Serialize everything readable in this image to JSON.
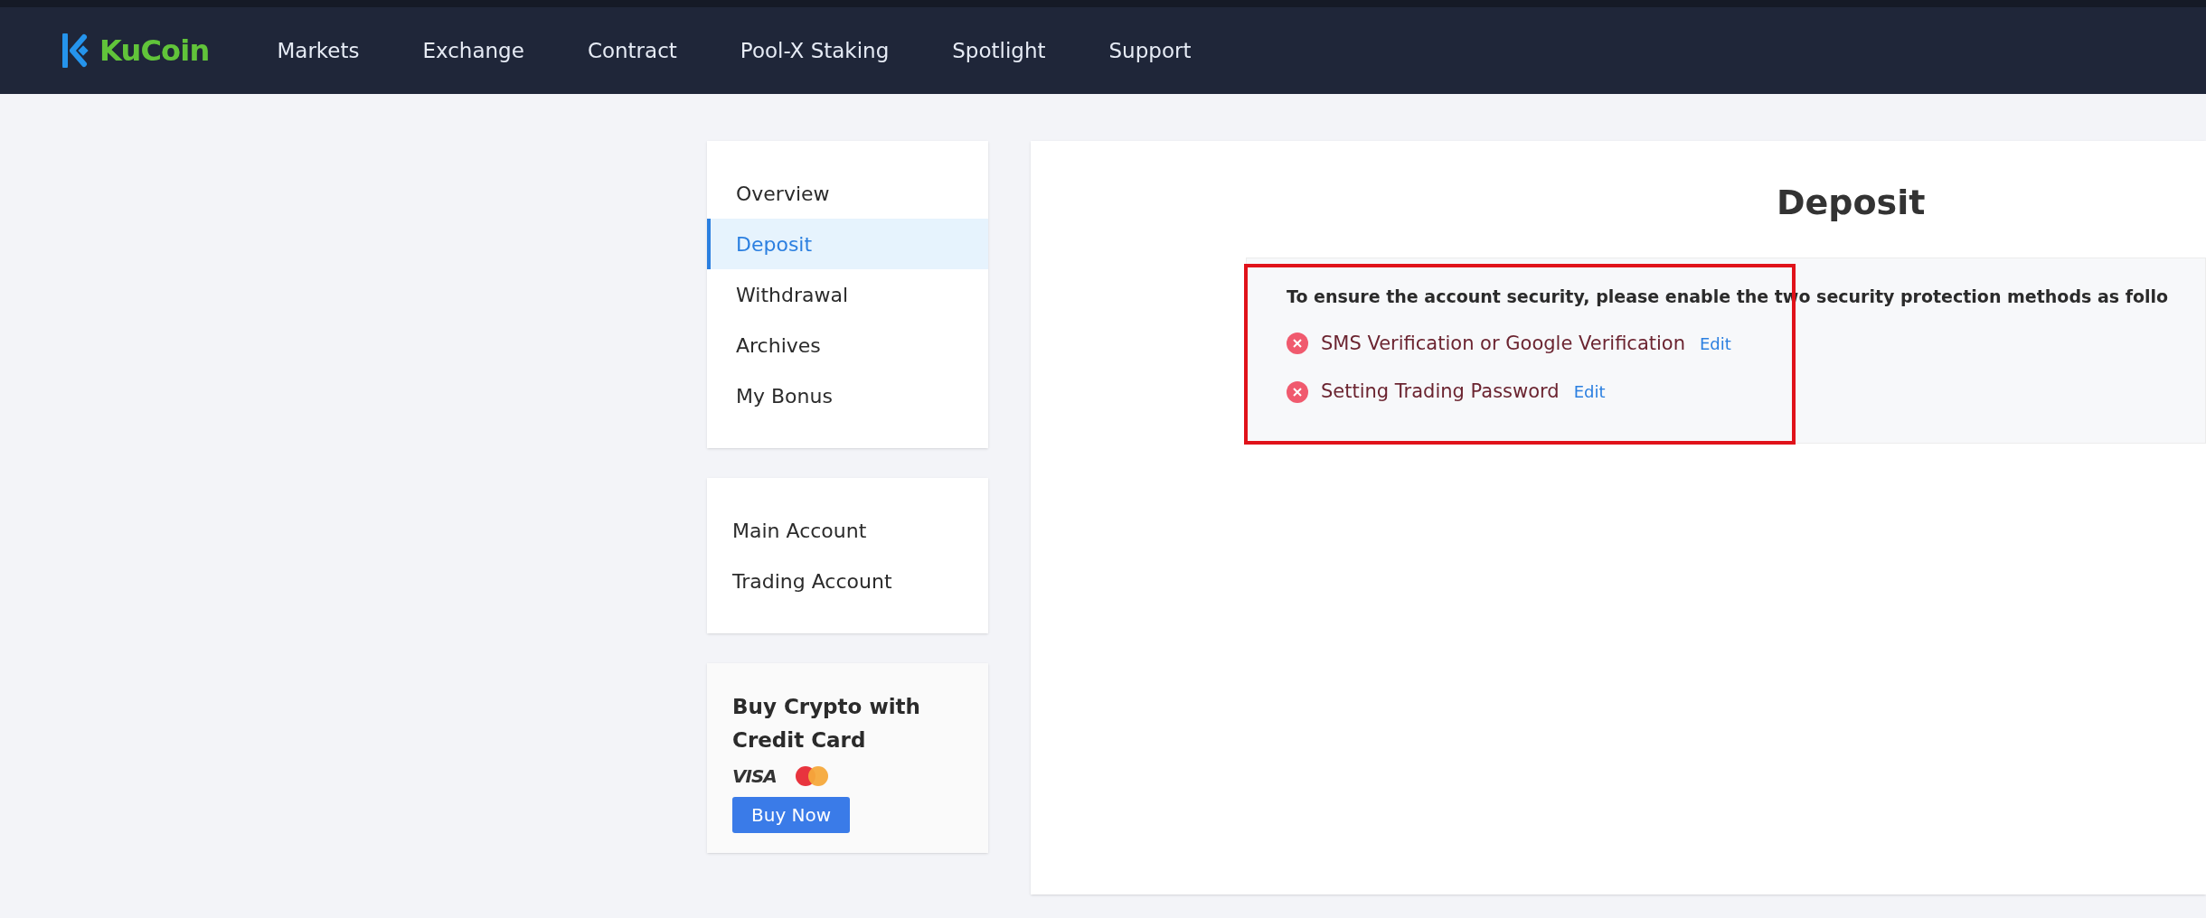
{
  "header": {
    "logo": "KuCoin",
    "nav": [
      {
        "label": "Markets"
      },
      {
        "label": "Exchange"
      },
      {
        "label": "Contract"
      },
      {
        "label": "Pool-X Staking"
      },
      {
        "label": "Spotlight"
      },
      {
        "label": "Support"
      }
    ]
  },
  "sidebar": {
    "menu": [
      {
        "label": "Overview",
        "selected": false
      },
      {
        "label": "Deposit",
        "selected": true
      },
      {
        "label": "Withdrawal",
        "selected": false
      },
      {
        "label": "Archives",
        "selected": false
      },
      {
        "label": "My Bonus",
        "selected": false
      }
    ],
    "accounts": [
      {
        "label": "Main Account"
      },
      {
        "label": "Trading Account"
      }
    ],
    "promo": {
      "title": "Buy Crypto with Credit Card",
      "card_brand": "VISA",
      "button": "Buy Now"
    }
  },
  "main": {
    "title": "Deposit",
    "notice": {
      "message": "To ensure the account security, please enable the two security protection methods as follo",
      "items": [
        {
          "label": "SMS Verification or Google Verification",
          "done": false,
          "action": "Edit"
        },
        {
          "label": "Setting Trading Password",
          "done": false,
          "action": "Edit"
        }
      ]
    }
  }
}
